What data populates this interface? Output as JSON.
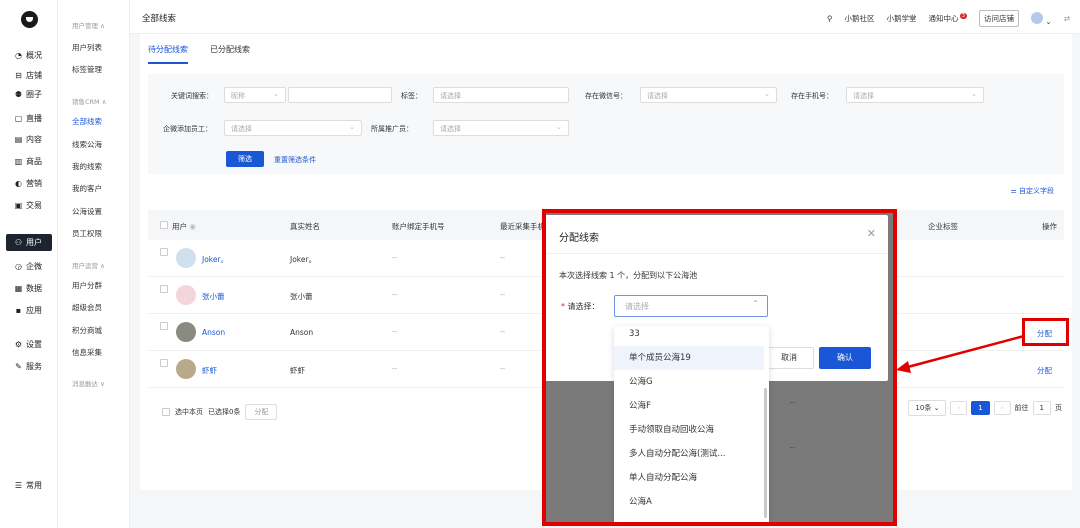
{
  "nav": {
    "items": [
      {
        "label": "概况",
        "icon": "◔"
      },
      {
        "label": "店铺",
        "icon": "⊟"
      },
      {
        "label": "圈子",
        "icon": "⚉"
      },
      {
        "label": "直播",
        "icon": "▢"
      },
      {
        "label": "内容",
        "icon": "▤"
      },
      {
        "label": "商品",
        "icon": "▥"
      },
      {
        "label": "营销",
        "icon": "◐"
      },
      {
        "label": "交易",
        "icon": "▣"
      },
      {
        "label": "用户",
        "icon": "⚇"
      },
      {
        "label": "企微",
        "icon": "◶"
      },
      {
        "label": "数据",
        "icon": "▦"
      },
      {
        "label": "应用",
        "icon": "▪"
      },
      {
        "label": "设置",
        "icon": "⚙"
      },
      {
        "label": "服务",
        "icon": "✎"
      }
    ],
    "bottom": {
      "label": "常用",
      "icon": "☰"
    }
  },
  "sub": {
    "group1": "用户管理 ∧",
    "g1_items": [
      "用户列表",
      "标签管理"
    ],
    "group2": "销售CRM ∧",
    "g2_items": [
      "全部线索",
      "线索公海",
      "我的线索",
      "我的客户",
      "公海设置",
      "员工权限"
    ],
    "group3": "用户运营 ∧",
    "g3_items": [
      "用户分群",
      "超级会员",
      "积分商城",
      "信息采集"
    ],
    "group4": "消息触达 ∨"
  },
  "topbar": {
    "title": "全部线索",
    "links": [
      "小鹅社区",
      "小鹅学堂"
    ],
    "notice": "通知中心",
    "notice_count": "3",
    "shop": "访问店铺"
  },
  "tabs": [
    "待分配线索",
    "已分配线索"
  ],
  "filters": {
    "keyword_label": "关键词搜索：",
    "keyword_type": "昵称",
    "tag_label": "标签：",
    "tag_ph": "请选择",
    "wechat_label": "存在微信号：",
    "wechat_ph": "请选择",
    "phone_label": "存在手机号：",
    "phone_ph": "请选择",
    "staff_label": "企微添加员工：",
    "staff_ph": "请选择",
    "promoter_label": "所属推广员：",
    "promoter_ph": "请选择",
    "filter_btn": "筛选",
    "reset_link": "重置筛选条件"
  },
  "custom_col": "自定义字段",
  "table": {
    "headers": [
      "用户",
      "真实姓名",
      "账户绑定手机号",
      "最近采集手机",
      "企业标签",
      "操作"
    ],
    "rows": [
      {
        "user": "Joker。",
        "real": "Joker。",
        "phone": "--",
        "collect": "--",
        "op": ""
      },
      {
        "user": "张小蕾",
        "real": "张小蕾",
        "phone": "--",
        "collect": "--",
        "op": ""
      },
      {
        "user": "Anson",
        "real": "Anson",
        "phone": "--",
        "collect": "--",
        "op": "分配"
      },
      {
        "user": "虾虾",
        "real": "虾虾",
        "phone": "--",
        "collect": "--",
        "op": "分配"
      }
    ]
  },
  "footer": {
    "select_page": "选中本页",
    "selected": "已选择0条",
    "assign": "分配",
    "per_page": "10条",
    "current_page": "1",
    "goto": "前往",
    "goto_page": "1",
    "page_unit": "页"
  },
  "modal": {
    "title": "分配线索",
    "desc": "本次选择线索 1 个，分配到以下公海池",
    "field_label": "请选择：",
    "placeholder": "请选择",
    "cancel": "取消",
    "confirm": "确认",
    "masked_dashes": [
      "--",
      "--"
    ]
  },
  "dropdown": {
    "options": [
      "33",
      "单个成员公海19",
      "公海G",
      "公海F",
      "手动领取自动回收公海",
      "多人自动分配公海(测试...",
      "单人自动分配公海",
      "公海A"
    ]
  }
}
